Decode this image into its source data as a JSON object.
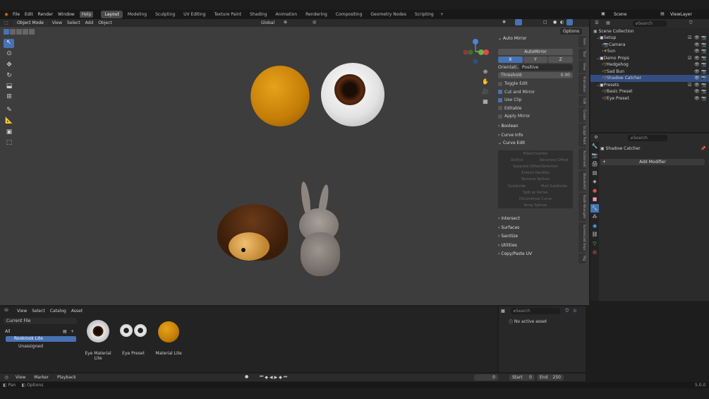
{
  "topbar": {
    "menus": [
      "File",
      "Edit",
      "Render",
      "Window",
      "Help"
    ],
    "workspaces": [
      "Layout",
      "Modeling",
      "Sculpting",
      "UV Editing",
      "Texture Paint",
      "Shading",
      "Animation",
      "Rendering",
      "Compositing",
      "Geometry Nodes",
      "Scripting"
    ],
    "scene": "Scene",
    "view_layer": "ViewLayer"
  },
  "viewport": {
    "mode": "Object Mode",
    "menus": [
      "View",
      "Select",
      "Add",
      "Object"
    ],
    "orientation": "Global",
    "options": "Options"
  },
  "npanel": {
    "title": "Auto Mirror",
    "button": "AutoMirror",
    "axes": [
      "X",
      "Y",
      "Z"
    ],
    "orientation_label": "Orientati...",
    "orientation_value": "Positive",
    "threshold_label": "Threshold",
    "threshold_value": "0.00",
    "checks": [
      {
        "label": "Toggle Edit",
        "on": false
      },
      {
        "label": "Cut and Mirror",
        "on": true
      },
      {
        "label": "Use Clip",
        "on": true
      },
      {
        "label": "Editable",
        "on": false
      },
      {
        "label": "Apply Mirror",
        "on": false
      }
    ],
    "sections_a": [
      "Boolean",
      "Curve Info"
    ],
    "curve_edit": "Curve Edit",
    "curve_buttons": [
      "Fillet/Chamfer",
      "Outline",
      "Recursive Offset",
      "Separate Offset/Selection",
      "Extend Handles",
      "Remove Splines",
      "Subdivide",
      "Mult Subdivide",
      "Split at Vertex",
      "Discontinue Curve",
      "Array Splines"
    ],
    "sections_b": [
      "Intersect",
      "Surfaces",
      "Sanitize",
      "Utilities",
      "Copy/Paste UV"
    ],
    "vtabs": [
      "Item",
      "Tool",
      "View",
      "Animation",
      "Edit",
      "Create",
      "Sculpt Paint",
      "Archimesh",
      "BlenderKit",
      "Node Wrangler",
      "Screencast Keys",
      "Rig"
    ]
  },
  "outliner": {
    "search": "Search",
    "collection": "Scene Collection",
    "items": [
      {
        "label": "Setup",
        "depth": 1,
        "kind": "collection"
      },
      {
        "label": "Camera",
        "depth": 2,
        "kind": "camera"
      },
      {
        "label": "Sun",
        "depth": 2,
        "kind": "light"
      },
      {
        "label": "Demo Props",
        "depth": 1,
        "kind": "collection"
      },
      {
        "label": "Hedgehog",
        "depth": 2,
        "kind": "mesh"
      },
      {
        "label": "Sad Bun",
        "depth": 2,
        "kind": "mesh"
      },
      {
        "label": "Shadow Catcher",
        "depth": 2,
        "kind": "mesh",
        "selected": true
      },
      {
        "label": "Presets",
        "depth": 1,
        "kind": "collection"
      },
      {
        "label": "Basic Preset",
        "depth": 2,
        "kind": "mesh"
      },
      {
        "label": "Eye Preset",
        "depth": 2,
        "kind": "mesh"
      }
    ]
  },
  "properties": {
    "search": "Search",
    "object": "Shadow Catcher",
    "add_modifier": "Add Modifier"
  },
  "asset_browser": {
    "menus": [
      "View",
      "Select",
      "Catalog",
      "Asset"
    ],
    "library": "Current File",
    "all": "All",
    "catalogs": [
      "Rookrook Lite",
      "Unassigned"
    ],
    "assets": [
      "Eye Material Lite",
      "Eye Preset",
      "Material Lite"
    ],
    "search": "Search",
    "no_active": "No active asset"
  },
  "timeline": {
    "menus": [
      "View",
      "Marker",
      "Playback"
    ],
    "frame": "0",
    "start_label": "Start",
    "start": "0",
    "end_label": "End",
    "end": "250"
  },
  "status": {
    "left": "Pan",
    "mid": "Options",
    "version": "5.0.0"
  }
}
